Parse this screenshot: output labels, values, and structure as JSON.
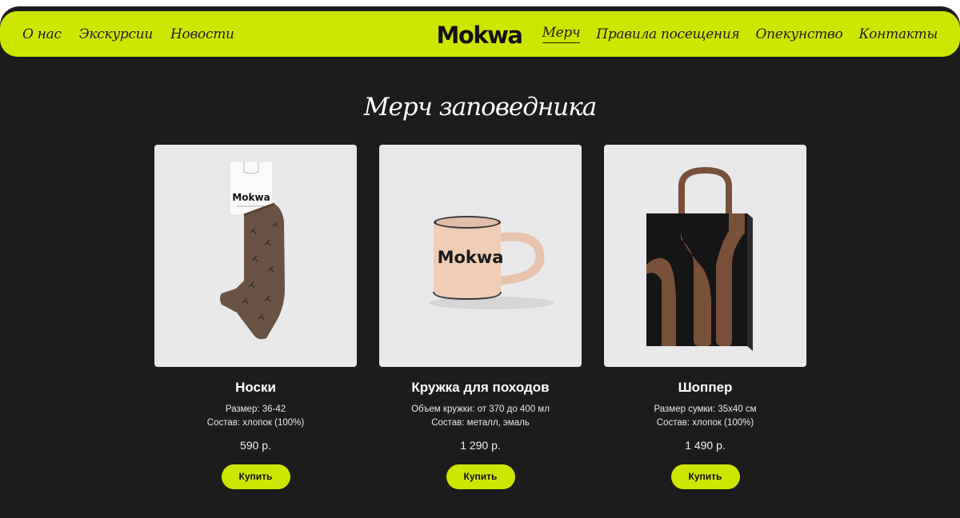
{
  "nav": {
    "left": [
      "О нас",
      "Экскурсии",
      "Новости"
    ],
    "right": [
      "Мерч",
      "Правила посещения",
      "Опекунство",
      "Контакты"
    ],
    "active": "Мерч"
  },
  "logo": "Mokwa",
  "heading": "Мерч заповедника",
  "products": [
    {
      "title": "Носки",
      "line1": "Размер: 36-42",
      "line2": "Состав: хлопок (100%)",
      "price": "590 р.",
      "button": "Купить",
      "tag_text": "Mokwa",
      "image": "brown-socks-with-tag"
    },
    {
      "title": "Кружка для походов",
      "line1": "Объем кружки: от 370 до 400 мл",
      "line2": "Состав: металл, эмаль",
      "price": "1 290 р.",
      "button": "Купить",
      "print_text": "Mokwa",
      "image": "peach-enamel-mug"
    },
    {
      "title": "Шоппер",
      "line1": "Размер сумки: 35x40 см",
      "line2": "Состав: хлопок (100%)",
      "price": "1 490 р.",
      "button": "Купить",
      "image": "black-tote-bag"
    }
  ],
  "colors": {
    "accent": "#cde600",
    "background": "#1c1c1c",
    "card_image_bg": "#e9e9eb"
  }
}
